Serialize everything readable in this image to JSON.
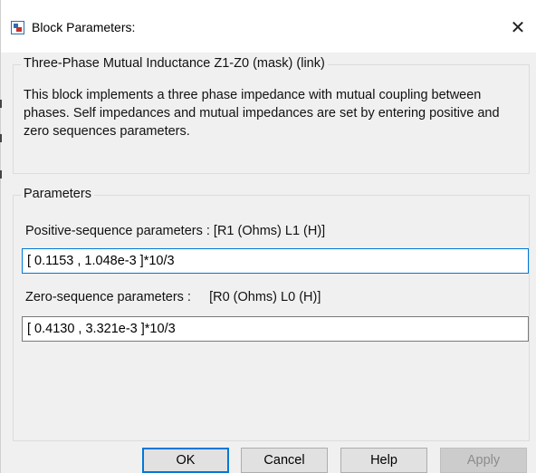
{
  "window": {
    "title": "Block Parameters:"
  },
  "mask": {
    "group_title": "Three-Phase Mutual Inductance Z1-Z0 (mask) (link)",
    "description": "This block implements a three phase impedance with mutual coupling between phases.  Self impedances and mutual impedances are set by entering positive and zero sequences parameters."
  },
  "parameters": {
    "group_title": "Parameters",
    "positive_label": "Positive-sequence parameters : [R1 (Ohms) L1 (H)]",
    "positive_value": "[ 0.1153 , 1.048e-3 ]*10/3",
    "zero_label": "Zero-sequence parameters :     [R0 (Ohms) L0 (H)]",
    "zero_value": "[ 0.4130 , 3.321e-3 ]*10/3"
  },
  "buttons": {
    "ok": "OK",
    "cancel": "Cancel",
    "help": "Help",
    "apply": "Apply"
  },
  "icons": {
    "app": "simulink-block-icon",
    "close": "close-icon"
  },
  "colors": {
    "focus_border": "#0078d7",
    "dialog_bg": "#f0f0f0"
  }
}
